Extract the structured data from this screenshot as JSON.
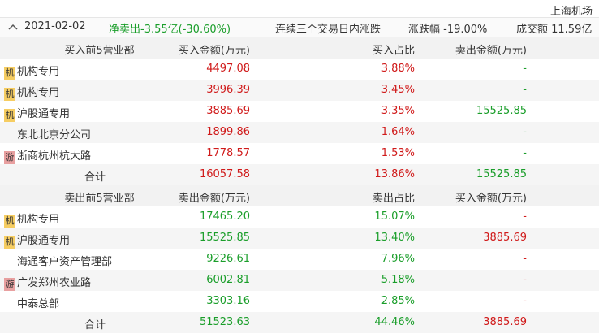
{
  "stock_name": "上海机场",
  "info": {
    "date": "2021-02-02",
    "net": "净卖出-3.55亿(-30.60%)",
    "reason": "连续三个交易日内涨跌",
    "change": "涨跌幅 -19.00%",
    "volume": "成交额 11.59亿"
  },
  "buy_section": {
    "headers": [
      "买入前5营业部",
      "买入金额(万元)",
      "买入占比",
      "卖出金额(万元)"
    ],
    "rows": [
      {
        "badge": "机",
        "name": "机构专用",
        "amount": "4497.08",
        "ratio": "3.88%",
        "other": "-"
      },
      {
        "badge": "机",
        "name": "机构专用",
        "amount": "3996.39",
        "ratio": "3.45%",
        "other": "-"
      },
      {
        "badge": "机",
        "name": "沪股通专用",
        "amount": "3885.69",
        "ratio": "3.35%",
        "other": "15525.85"
      },
      {
        "badge": "",
        "name": "东北北京分公司",
        "amount": "1899.86",
        "ratio": "1.64%",
        "other": "-"
      },
      {
        "badge": "游",
        "name": "浙商杭州杭大路",
        "amount": "1778.57",
        "ratio": "1.53%",
        "other": "-"
      }
    ],
    "total": {
      "label": "合计",
      "amount": "16057.58",
      "ratio": "13.86%",
      "other": "15525.85"
    }
  },
  "sell_section": {
    "headers": [
      "卖出前5营业部",
      "卖出金额(万元)",
      "卖出占比",
      "买入金额(万元)"
    ],
    "rows": [
      {
        "badge": "机",
        "name": "机构专用",
        "amount": "17465.20",
        "ratio": "15.07%",
        "other": "-"
      },
      {
        "badge": "机",
        "name": "沪股通专用",
        "amount": "15525.85",
        "ratio": "13.40%",
        "other": "3885.69"
      },
      {
        "badge": "",
        "name": "海通客户资产管理部",
        "amount": "9226.61",
        "ratio": "7.96%",
        "other": "-"
      },
      {
        "badge": "游",
        "name": "广发郑州农业路",
        "amount": "6002.81",
        "ratio": "5.18%",
        "other": "-"
      },
      {
        "badge": "",
        "name": "中泰总部",
        "amount": "3303.16",
        "ratio": "2.85%",
        "other": "-"
      }
    ],
    "total": {
      "label": "合计",
      "amount": "51523.63",
      "ratio": "44.46%",
      "other": "3885.69"
    }
  },
  "colors": {
    "buy": "#d01a1a",
    "sell": "#1a9e2a",
    "badge_institution": "#f6cd62",
    "badge_hot": "#e8a0a0"
  }
}
